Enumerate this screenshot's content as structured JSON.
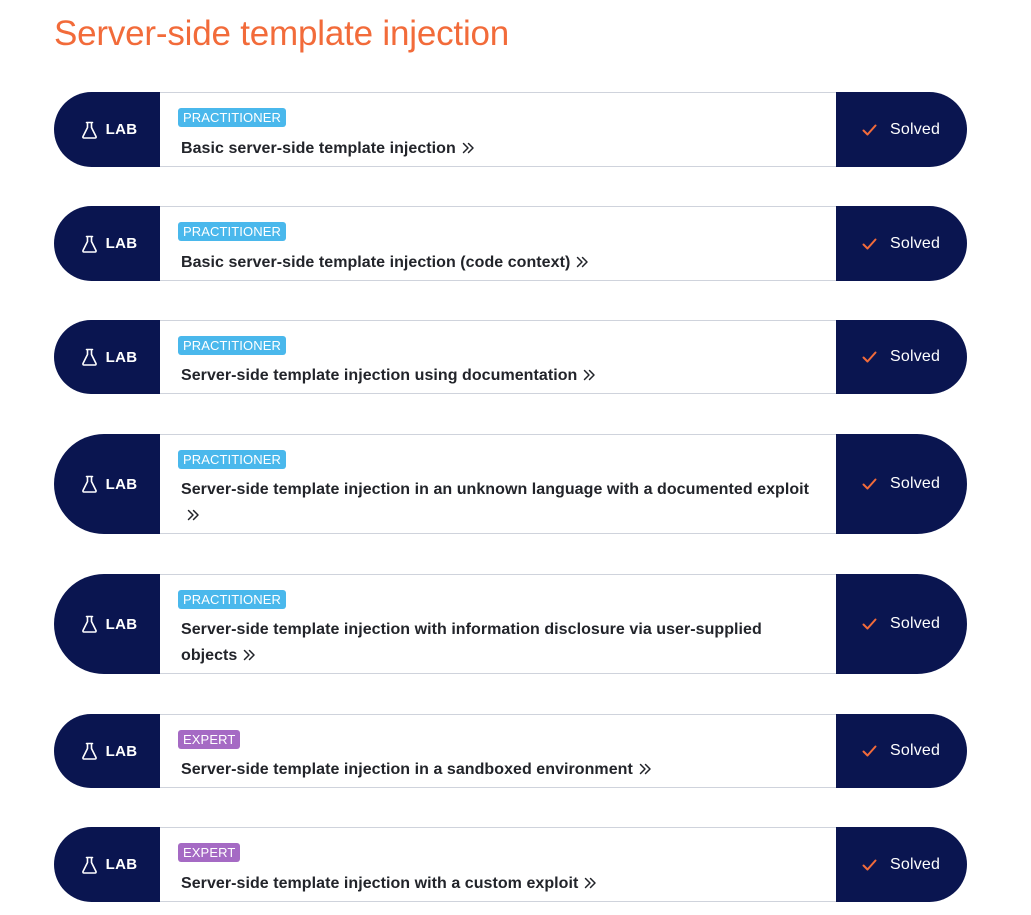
{
  "page": {
    "title": "Server-side template injection"
  },
  "colors": {
    "accent": "#f26b3a",
    "navy": "#0a1550",
    "practitioner": "#4ab8ec",
    "expert": "#a56ac4",
    "check": "#f26b3a"
  },
  "labs": [
    {
      "type_label": "LAB",
      "level": "PRACTITIONER",
      "title": "Basic server-side template injection",
      "status": "Solved"
    },
    {
      "type_label": "LAB",
      "level": "PRACTITIONER",
      "title": "Basic server-side template injection (code context)",
      "status": "Solved"
    },
    {
      "type_label": "LAB",
      "level": "PRACTITIONER",
      "title": "Server-side template injection using documentation",
      "status": "Solved"
    },
    {
      "type_label": "LAB",
      "level": "PRACTITIONER",
      "title": "Server-side template injection in an unknown language with a documented exploit",
      "status": "Solved"
    },
    {
      "type_label": "LAB",
      "level": "PRACTITIONER",
      "title": "Server-side template injection with information disclosure via user-supplied objects",
      "status": "Solved"
    },
    {
      "type_label": "LAB",
      "level": "EXPERT",
      "title": "Server-side template injection in a sandboxed environment",
      "status": "Solved"
    },
    {
      "type_label": "LAB",
      "level": "EXPERT",
      "title": "Server-side template injection with a custom exploit",
      "status": "Solved"
    }
  ]
}
